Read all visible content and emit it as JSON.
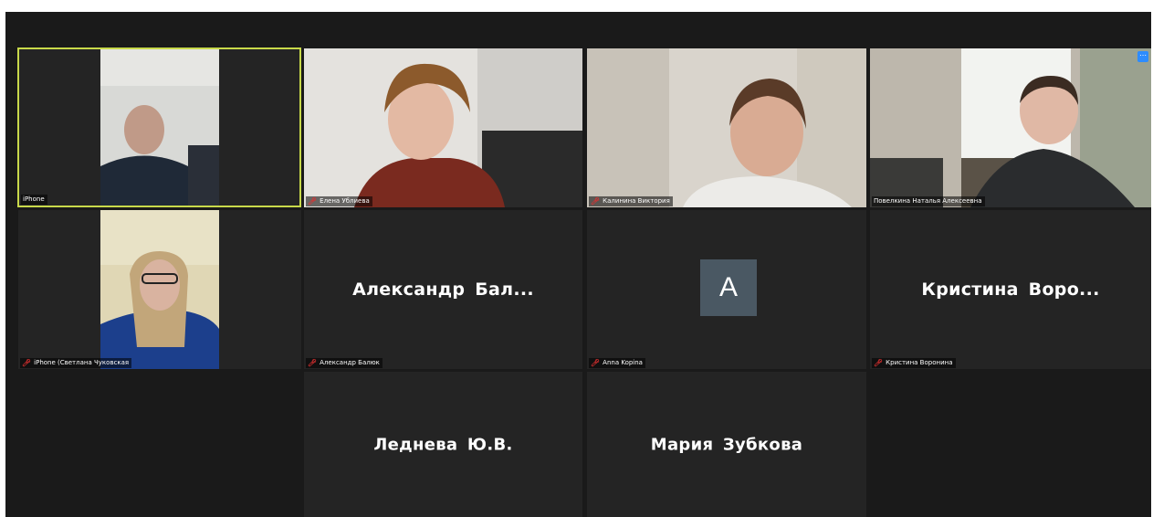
{
  "tiles": [
    {
      "label": "iPhone"
    },
    {
      "label": "Елена Ублиева"
    },
    {
      "label": "Калинина Виктория"
    },
    {
      "label": "Повелкина Наталья Алексеевна"
    },
    {
      "label": "iPhone (Светлана Чуковская"
    },
    {
      "label": "Александр Балюк",
      "display_name": "Александр  Бал..."
    },
    {
      "label": "Anna Kopina",
      "avatar_letter": "A"
    },
    {
      "label": "Кристина Воронина",
      "display_name": "Кристина  Воро..."
    },
    {
      "display_name": "Леднева Ю.В."
    },
    {
      "display_name": "Мария Зубкова"
    }
  ],
  "colors": {
    "active_speaker_border": "#c8d94a",
    "muted_mic": "#e03030",
    "tile_bg": "#242424",
    "avatar_bg": "#4a5863"
  },
  "icons": {
    "mic_muted": "mic-muted-icon",
    "tile_options": "tile-options-icon"
  }
}
